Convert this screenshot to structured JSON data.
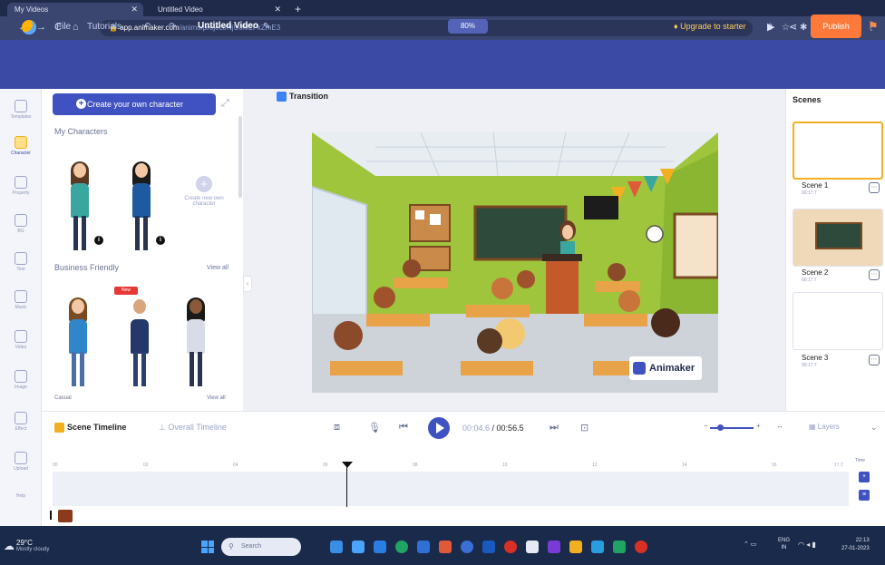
{
  "browser": {
    "tabs": [
      {
        "label": "My Videos"
      },
      {
        "label": "Untitled Video"
      }
    ],
    "url_host": "app.animaker.com",
    "url_path": "/animo/project/NjU0M2FkZmE3"
  },
  "header": {
    "menu": [
      "File",
      "Tutorials"
    ],
    "video_title": "Untitled Video",
    "zoom": "80%",
    "upgrade": "Upgrade to starter",
    "publish": "Publish"
  },
  "rail": {
    "items": [
      "Templates",
      "Character",
      "Property",
      "BG",
      "Text",
      "Music",
      "Video",
      "Image",
      "Effect",
      "Upload",
      "Help"
    ]
  },
  "panel": {
    "create_button": "Create your own character",
    "my_characters": "My Characters",
    "create_new": "Create new own character",
    "business_friendly": "Business Friendly",
    "view_all": "View all",
    "new_badge": "New",
    "casual": "Casual",
    "casual_view_all": "View all"
  },
  "stage": {
    "transition": "Transition",
    "watermark": "Animaker"
  },
  "scenes": {
    "title": "Scenes",
    "items": [
      {
        "name": "Scene 1",
        "duration": "00:17.7"
      },
      {
        "name": "Scene 2",
        "duration": "00:17.7"
      },
      {
        "name": "Scene 3",
        "duration": "00:17.7"
      }
    ]
  },
  "timeline": {
    "scene_timeline": "Scene Timeline",
    "overall_timeline": "Overall Timeline",
    "current_time": "00:04.6",
    "total_time": "00:56.5",
    "layers": "Layers",
    "time_label": "Time",
    "ruler": [
      "00",
      "02",
      "04",
      "06",
      "08",
      "10",
      "12",
      "14",
      "16",
      "17.7"
    ]
  },
  "taskbar": {
    "temp": "29°C",
    "weather": "Mostly cloudy",
    "search": "Search",
    "lang_1": "ENG",
    "lang_2": "IN",
    "time": "22:13",
    "date": "27-01-2023"
  },
  "colors": {
    "appbar": "#3b4aa4",
    "accent": "#4052c2",
    "publish": "#ff7a3a"
  }
}
